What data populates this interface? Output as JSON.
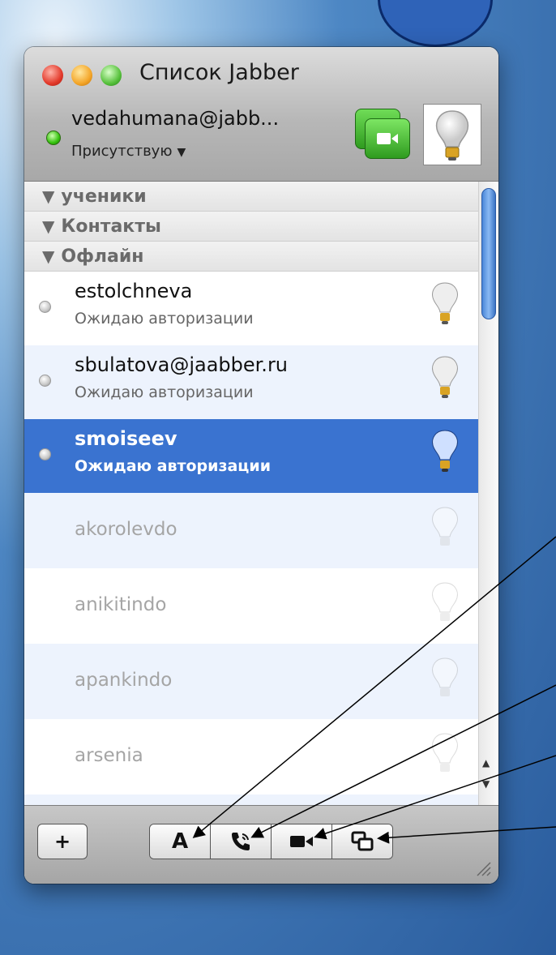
{
  "window": {
    "title": "Список Jabber",
    "account": "vedahumana@jabb...",
    "presence": "Присутствую"
  },
  "groups": [
    {
      "label": "ученики"
    },
    {
      "label": "Контакты"
    },
    {
      "label": "Офлайн"
    }
  ],
  "contacts": [
    {
      "name": "estolchneva",
      "status": "Ожидаю авторизации"
    },
    {
      "name": "sbulatova@jaabber.ru",
      "status": "Ожидаю авторизации"
    },
    {
      "name": "smoiseev",
      "status": "Ожидаю авторизации"
    },
    {
      "name": "akorolevdo"
    },
    {
      "name": "anikitindo"
    },
    {
      "name": "apankindo"
    },
    {
      "name": "arsenia"
    }
  ],
  "toolbar": {
    "add_label": "+",
    "font_label": "A"
  },
  "icons": {
    "traffic": [
      "close-icon",
      "minimize-icon",
      "maximize-icon"
    ],
    "video": "video-chat-icon",
    "avatar": "lightbulb-icon",
    "toolbar": [
      "font-icon",
      "phone-call-icon",
      "video-camera-icon",
      "share-screen-icon"
    ]
  },
  "colors": {
    "selection": "#3a73d0",
    "alt_row": "#edf3fd",
    "online": "#35c30e"
  }
}
